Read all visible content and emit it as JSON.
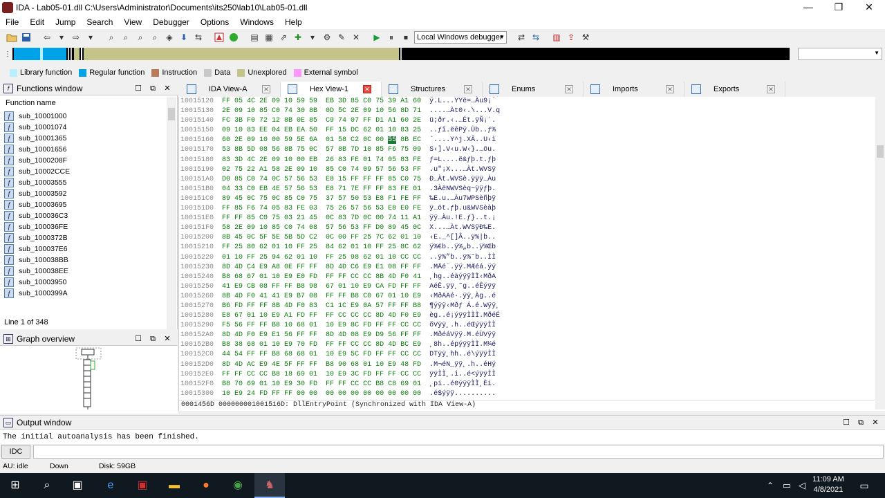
{
  "window": {
    "title": "IDA - Lab05-01.dll C:\\Users\\Administrator\\Documents\\its250\\lab10\\Lab05-01.dll",
    "minimize": "—",
    "maximize": "❐",
    "close": "✕"
  },
  "menu": [
    "File",
    "Edit",
    "Jump",
    "Search",
    "View",
    "Debugger",
    "Options",
    "Windows",
    "Help"
  ],
  "toolbar": {
    "debugger_select": "Local Windows debugger"
  },
  "legend": [
    {
      "label": "Library function",
      "color": "#b7efff"
    },
    {
      "label": "Regular function",
      "color": "#00a2e8"
    },
    {
      "label": "Instruction",
      "color": "#b97a57"
    },
    {
      "label": "Data",
      "color": "#c8c8c8"
    },
    {
      "label": "Unexplored",
      "color": "#c3c38a"
    },
    {
      "label": "External symbol",
      "color": "#ff95ff"
    }
  ],
  "functions": {
    "title": "Functions window",
    "column": "Function name",
    "items": [
      "sub_10001000",
      "sub_10001074",
      "sub_10001365",
      "sub_10001656",
      "sub_1000208F",
      "sub_10002CCE",
      "sub_10003555",
      "sub_10003592",
      "sub_10003695",
      "sub_100036C3",
      "sub_100036FE",
      "sub_1000372B",
      "sub_100037E6",
      "sub_100038BB",
      "sub_100038EE",
      "sub_10003950",
      "sub_1000399A"
    ],
    "line_info": "Line 1 of 348"
  },
  "graph": {
    "title": "Graph overview"
  },
  "tabs": [
    {
      "label": "IDA View-A",
      "active": false
    },
    {
      "label": "Hex View-1",
      "active": true
    },
    {
      "label": "Structures",
      "active": false
    },
    {
      "label": "Enums",
      "active": false
    },
    {
      "label": "Imports",
      "active": false
    },
    {
      "label": "Exports",
      "active": false
    }
  ],
  "hex": {
    "rows": [
      {
        "addr": "10015120",
        "bytes": "FF 05 4C 2E 09 10 59 59  EB 3D 85 C0 75 39 A1 60",
        "ascii": "ÿ.L...YYë=…Àu9¡`"
      },
      {
        "addr": "10015130",
        "bytes": "2E 09 10 85 C0 74 30 8B  0D 5C 2E 09 10 56 8D 71",
        "ascii": "....…Àt0‹.\\...V.q"
      },
      {
        "addr": "10015140",
        "bytes": "FC 3B F0 72 12 8B 0E 85  C9 74 07 FF D1 A1 60 2E",
        "ascii": "ü;ðr.‹.…Ét.ÿÑ¡`."
      },
      {
        "addr": "10015150",
        "bytes": "09 10 83 EE 04 EB EA 50  FF 15 DC 62 01 10 83 25",
        "ascii": "..ƒî.ëêPÿ.Üb..ƒ%"
      },
      {
        "addr": "10015160",
        "bytes": "60 2E 09 10 00 59 5E 6A  01 58 C2 0C 00 55 8B EC",
        "ascii": "`....Y^j.XÂ..U‹ì"
      },
      {
        "addr": "10015170",
        "bytes": "53 8B 5D 08 56 8B 75 0C  57 8B 7D 10 85 F6 75 09",
        "ascii": "S‹].V‹u.W‹}.…öu."
      },
      {
        "addr": "10015180",
        "bytes": "83 3D 4C 2E 09 10 00 EB  26 83 FE 01 74 05 83 FE",
        "ascii": "ƒ=L....ë&ƒþ.t.ƒþ"
      },
      {
        "addr": "10015190",
        "bytes": "02 75 22 A1 58 2E 09 10  85 C0 74 09 57 56 53 FF",
        "ascii": ".u\"¡X...…Àt.WVSÿ"
      },
      {
        "addr": "100151A0",
        "bytes": "D0 85 C0 74 0C 57 56 53  E8 15 FF FF FF 85 C0 75",
        "ascii": "Ð…Àt.WVSè.ÿÿÿ…Àu"
      },
      {
        "addr": "100151B0",
        "bytes": "04 33 C0 EB 4E 57 56 53  E8 71 7E FF FF 83 FE 01",
        "ascii": ".3ÀëNWVSèq~ÿÿƒþ."
      },
      {
        "addr": "100151C0",
        "bytes": "89 45 0C 75 0C 85 C0 75  37 57 50 53 E8 F1 FE FF",
        "ascii": "‰E.u.…Àu7WPSèñþÿ"
      },
      {
        "addr": "100151D0",
        "bytes": "FF 85 F6 74 05 83 FE 03  75 26 57 56 53 E8 E0 FE",
        "ascii": "ÿ…öt.ƒþ.u&WVSèàþ"
      },
      {
        "addr": "100151E0",
        "bytes": "FF FF 85 C0 75 03 21 45  0C 83 7D 0C 00 74 11 A1",
        "ascii": "ÿÿ…Àu.!E.ƒ}..t.¡"
      },
      {
        "addr": "100151F0",
        "bytes": "58 2E 09 10 85 C0 74 08  57 56 53 FF D0 89 45 0C",
        "ascii": "X...…Àt.WVSÿÐ‰E."
      },
      {
        "addr": "10015200",
        "bytes": "8B 45 0C 5F 5E 5B 5D C2  0C 00 FF 25 7C 62 01 10",
        "ascii": "‹E._^[]Â..ÿ%|b.."
      },
      {
        "addr": "10015210",
        "bytes": "FF 25 80 62 01 10 FF 25  84 62 01 10 FF 25 8C 62",
        "ascii": "ÿ%€b..ÿ%„b..ÿ%Œb"
      },
      {
        "addr": "10015220",
        "bytes": "01 10 FF 25 94 62 01 10  FF 25 98 62 01 10 CC CC",
        "ascii": "..ÿ%”b..ÿ%˜b..ÌÌ"
      },
      {
        "addr": "10015230",
        "bytes": "8D 4D C4 E9 A8 0E FF FF  8D 4D C6 E9 E1 08 FF FF",
        "ascii": ".MÄé¨.ÿÿ.MÆéá.ÿÿ"
      },
      {
        "addr": "10015240",
        "bytes": "B8 68 67 01 10 E9 E0 FD  FF FF CC CC 8B 4D F0 41",
        "ascii": "¸hg..éàýÿÿÌÌ‹MðA"
      },
      {
        "addr": "10015250",
        "bytes": "41 E9 CB 08 FF FF B8 98  67 01 10 E9 CA FD FF FF",
        "ascii": "AéË.ÿÿ¸˜g..éÊýÿÿ"
      },
      {
        "addr": "10015260",
        "bytes": "8B 4D F0 41 41 E9 B7 08  FF FF B8 C0 67 01 10 E9",
        "ascii": "‹MðAAé·.ÿÿ¸Àg..é"
      },
      {
        "addr": "10015270",
        "bytes": "B6 FD FF FF 8B 4D F0 83  C1 1C E9 0A 57 FF FF B8",
        "ascii": "¶ýÿÿ‹Mðƒ Á.é.Wÿÿ¸"
      },
      {
        "addr": "10015280",
        "bytes": "E8 67 01 10 E9 A1 FD FF  FF CC CC CC 8D 4D F0 E9",
        "ascii": "èg..é¡ýÿÿÌÌÌ.MðéÉ"
      },
      {
        "addr": "10015290",
        "bytes": "F5 56 FF FF B8 10 68 01  10 E9 8C FD FF FF CC CC",
        "ascii": "õVÿÿ¸.h..éŒýÿÿÌÌ"
      },
      {
        "addr": "100152A0",
        "bytes": "8D 4D F0 E9 E1 56 FF FF  8D 4D 08 E9 D9 56 FF FF",
        "ascii": ".MðéáVÿÿ.M.éÙVÿÿ"
      },
      {
        "addr": "100152B0",
        "bytes": "B8 38 68 01 10 E9 70 FD  FF FF CC CC 8D 4D BC E9",
        "ascii": "¸8h..épýÿÿÌÌ.M¼é"
      },
      {
        "addr": "100152C0",
        "bytes": "44 54 FF FF B8 68 68 01  10 E9 5C FD FF FF CC CC",
        "ascii": "DTÿÿ¸hh..é\\ýÿÿÌÌ"
      },
      {
        "addr": "100152D0",
        "bytes": "8D 4D AC E9 4E 5F FF FF  B8 90 68 01 10 E9 48 FD",
        "ascii": ".M¬éN_ÿÿ¸.h..éHý"
      },
      {
        "addr": "100152E0",
        "bytes": "FF FF CC CC B8 18 69 01  10 E9 3C FD FF FF CC CC",
        "ascii": "ÿÿÌÌ¸.i..é<ýÿÿÌÌ"
      },
      {
        "addr": "100152F0",
        "bytes": "B8 70 69 01 10 E9 30 FD  FF FF CC CC B8 C8 69 01",
        "ascii": "¸pi..é0ýÿÿÌÌ¸Èi."
      },
      {
        "addr": "10015300",
        "bytes": "10 E9 24 FD FF FF 00 00  00 00 00 00 00 00 00 00",
        "ascii": ".é$ýÿÿ.........."
      }
    ],
    "status": "0001456D 000000001001516D: DllEntryPoint (Synchronized with IDA View-A)"
  },
  "output": {
    "title": "Output window",
    "message": "The initial autoanalysis has been finished."
  },
  "idc": {
    "button": "IDC"
  },
  "status": {
    "au": "AU:  idle",
    "dir": "Down",
    "disk": "Disk: 59GB"
  },
  "taskbar": {
    "time": "11:09 AM",
    "date": "4/8/2021"
  }
}
